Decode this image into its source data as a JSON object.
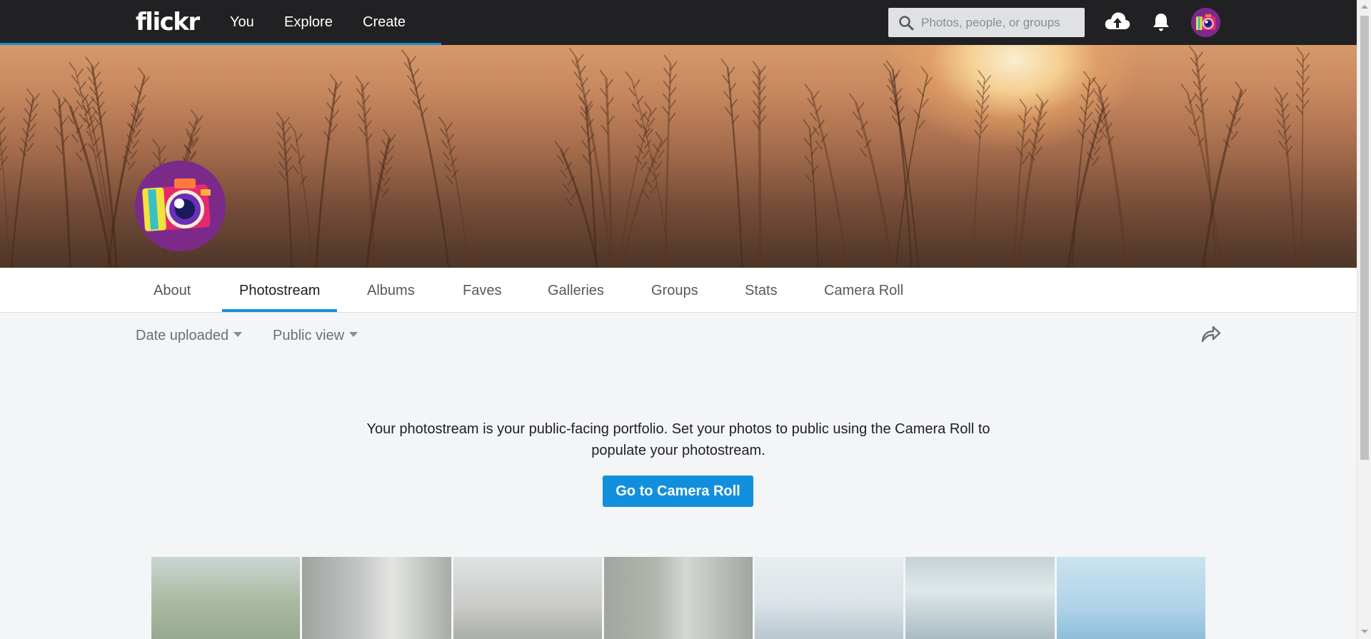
{
  "nav": {
    "logo": "flickr",
    "links": [
      "You",
      "Explore",
      "Create"
    ],
    "search_placeholder": "Photos, people, or groups",
    "icons": [
      "upload-icon",
      "notification-bell-icon",
      "user-avatar"
    ]
  },
  "profile": {
    "avatar": "camera-buddy-icon"
  },
  "tabs": {
    "items": [
      "About",
      "Photostream",
      "Albums",
      "Faves",
      "Galleries",
      "Groups",
      "Stats",
      "Camera Roll"
    ],
    "active": "Photostream"
  },
  "filters": {
    "sort": "Date uploaded",
    "view": "Public view"
  },
  "empty_state": {
    "message": "Your photostream is your public-facing portfolio. Set your photos to public using the Camera Roll to populate your photostream.",
    "button": "Go to Camera Roll"
  },
  "colors": {
    "nav_bg": "#212124",
    "accent": "#128fdc",
    "page_bg": "#f3f5f6"
  }
}
